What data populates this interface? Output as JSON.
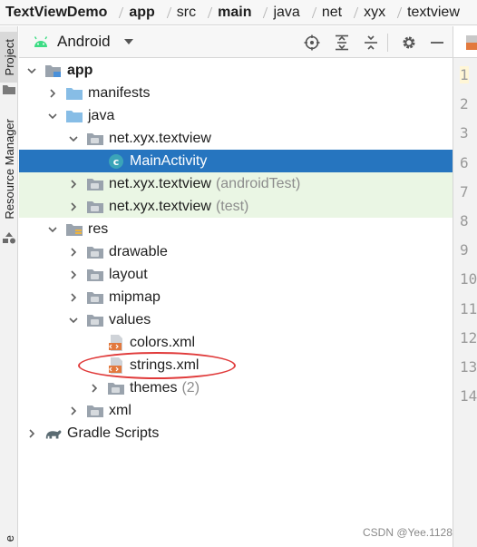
{
  "breadcrumb": [
    {
      "label": "TextViewDemo",
      "bold": true
    },
    {
      "label": "app",
      "bold": true
    },
    {
      "label": "src",
      "bold": false
    },
    {
      "label": "main",
      "bold": true
    },
    {
      "label": "java",
      "bold": false
    },
    {
      "label": "net",
      "bold": false
    },
    {
      "label": "xyx",
      "bold": false
    },
    {
      "label": "textview",
      "bold": false
    }
  ],
  "side_stripe": {
    "project_label": "Project",
    "resource_manager_label": "Resource Manager",
    "bottom_fragment": "e"
  },
  "toolbar": {
    "view_label": "Android",
    "icons": [
      "locate-icon",
      "expand-all-icon",
      "collapse-all-icon",
      "settings-icon",
      "minimize-icon"
    ]
  },
  "tree": [
    {
      "label": "app",
      "depth": 0,
      "expanded": true,
      "icon": "module-folder",
      "bold": true
    },
    {
      "label": "manifests",
      "depth": 1,
      "expanded": false,
      "icon": "folder-blue"
    },
    {
      "label": "java",
      "depth": 1,
      "expanded": true,
      "icon": "folder-blue"
    },
    {
      "label": "net.xyx.textview",
      "depth": 2,
      "expanded": true,
      "icon": "package"
    },
    {
      "label": "MainActivity",
      "depth": 3,
      "expanded": null,
      "icon": "class",
      "selected": true
    },
    {
      "label": "net.xyx.textview",
      "extra": "(androidTest)",
      "depth": 2,
      "expanded": false,
      "icon": "package",
      "test": true
    },
    {
      "label": "net.xyx.textview",
      "extra": "(test)",
      "depth": 2,
      "expanded": false,
      "icon": "package",
      "test": true
    },
    {
      "label": "res",
      "depth": 1,
      "expanded": true,
      "icon": "res-folder"
    },
    {
      "label": "drawable",
      "depth": 2,
      "expanded": false,
      "icon": "package"
    },
    {
      "label": "layout",
      "depth": 2,
      "expanded": false,
      "icon": "package"
    },
    {
      "label": "mipmap",
      "depth": 2,
      "expanded": false,
      "icon": "package"
    },
    {
      "label": "values",
      "depth": 2,
      "expanded": true,
      "icon": "package"
    },
    {
      "label": "colors.xml",
      "depth": 3,
      "expanded": null,
      "icon": "xml"
    },
    {
      "label": "strings.xml",
      "depth": 3,
      "expanded": null,
      "icon": "xml"
    },
    {
      "label": "themes",
      "extra": "(2)",
      "depth": 3,
      "expanded": false,
      "icon": "package"
    },
    {
      "label": "xml",
      "depth": 2,
      "expanded": false,
      "icon": "package"
    },
    {
      "label": "Gradle Scripts",
      "depth": 0,
      "expanded": false,
      "icon": "gradle"
    }
  ],
  "editor_line_numbers": [
    "1",
    "2",
    "3",
    "6",
    "7",
    "8",
    "9",
    "10",
    "11",
    "12",
    "13",
    "14"
  ],
  "watermark": "CSDN @Yee.1128",
  "colors": {
    "selection": "#2675bf",
    "test_background": "#eaf6e4",
    "annotation_ring": "#e03a3a",
    "android_green": "#3ddc84"
  }
}
